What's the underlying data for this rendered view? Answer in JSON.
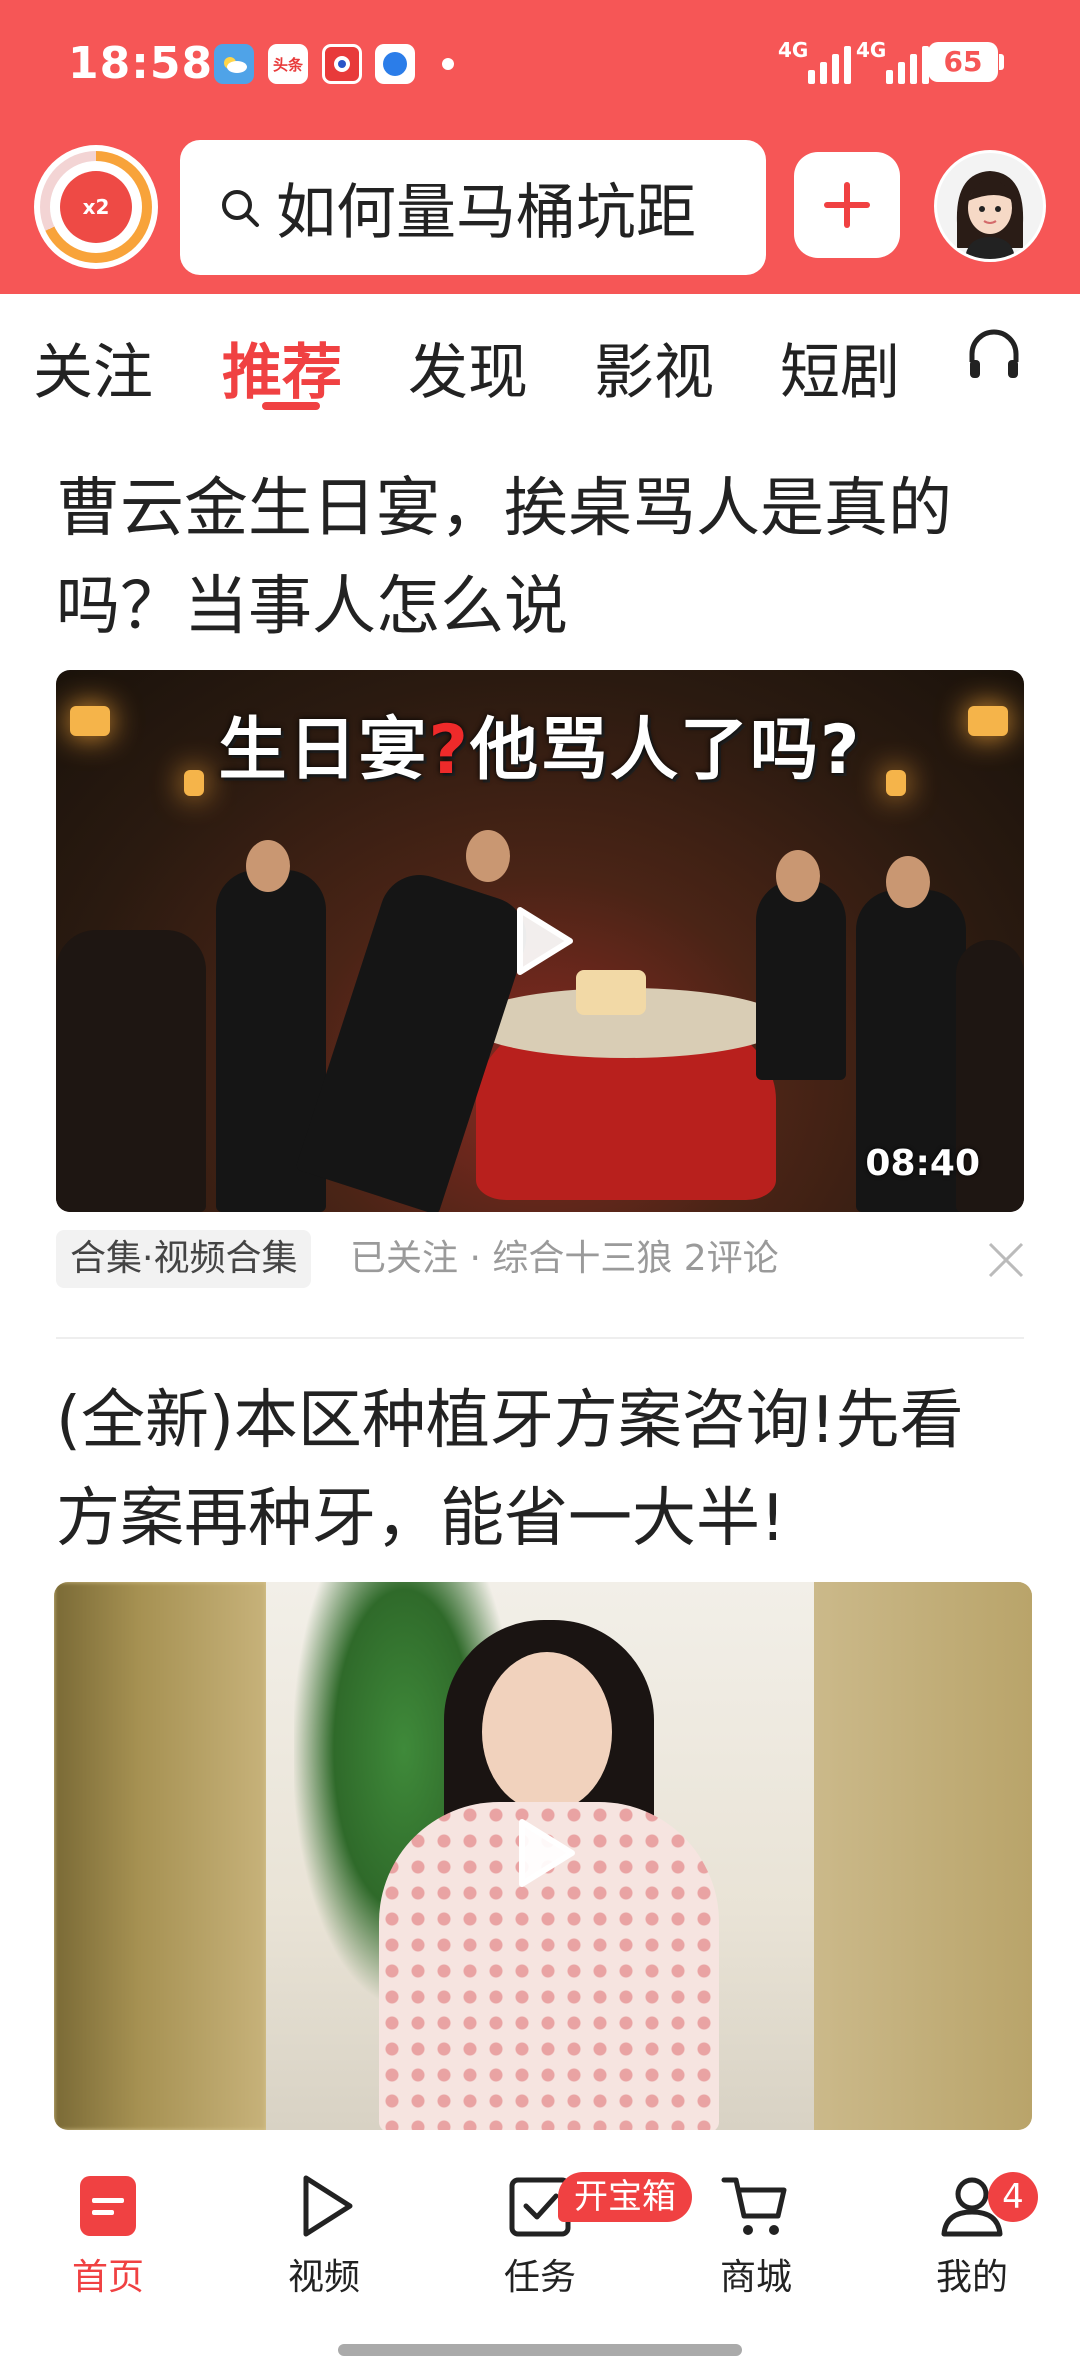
{
  "status_bar": {
    "time": "18:58",
    "network_1": "4G",
    "network_2": "4G",
    "battery": "65",
    "notif_toutiao": "头条"
  },
  "header": {
    "coin_badge": "x2",
    "search_text": "如何量马桶坑距",
    "colors": {
      "accent": "#f65656",
      "active_tab": "#f04142"
    }
  },
  "tabs": [
    {
      "label": "关注"
    },
    {
      "label": "推荐",
      "active": true
    },
    {
      "label": "发现"
    },
    {
      "label": "影视"
    },
    {
      "label": "短剧"
    }
  ],
  "feed": {
    "item1": {
      "title": "曹云金生日宴，挨桌骂人是真的吗？当事人怎么说",
      "banner_part1": "生日宴",
      "banner_q": "?",
      "banner_part2": "他骂人了吗?",
      "duration": "08:40",
      "tag": "合集·视频合集",
      "meta": "已关注 · 综合十三狼  2评论"
    },
    "item2": {
      "title": "(全新)本区种植牙方案咨询!先看方案再种牙，能省一大半!"
    }
  },
  "bottom_nav": {
    "items": [
      {
        "label": "首页",
        "icon": "home-icon",
        "active": true
      },
      {
        "label": "视频",
        "icon": "video-play-icon"
      },
      {
        "label": "任务",
        "icon": "task-icon"
      },
      {
        "label": "商城",
        "icon": "cart-icon"
      },
      {
        "label": "我的",
        "icon": "profile-icon"
      }
    ],
    "task_badge": "开宝箱",
    "profile_badge": "4"
  }
}
